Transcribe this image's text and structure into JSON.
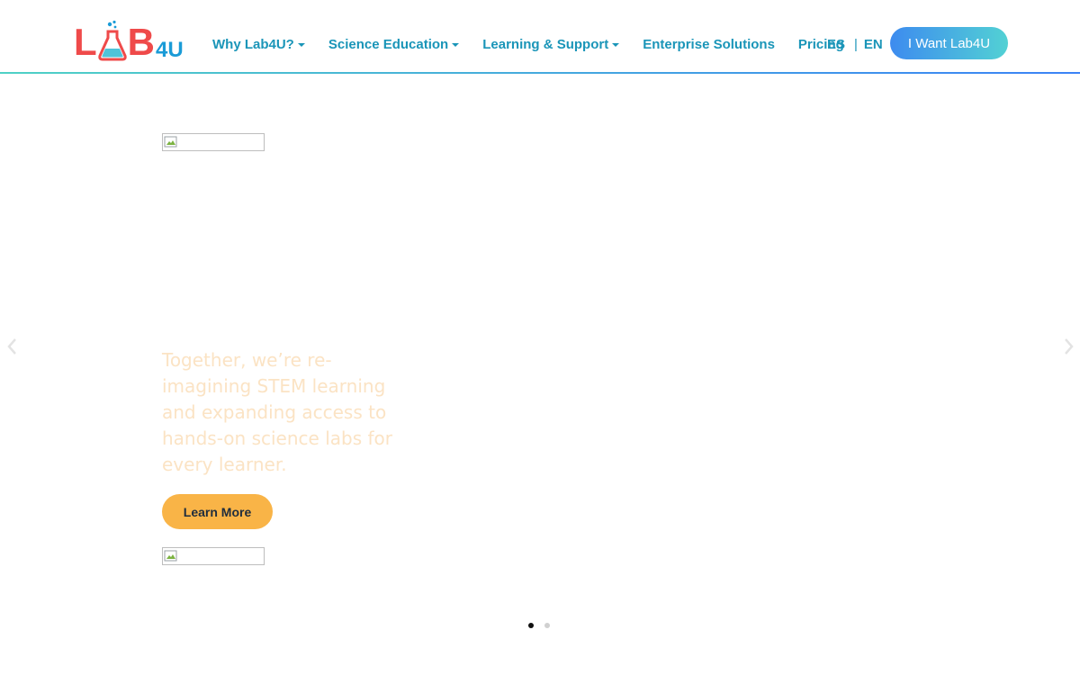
{
  "brand": {
    "logo_letter_1": "L",
    "logo_letter_2": "B",
    "logo_suffix": "4U",
    "logo_red": "#ef4a4a",
    "logo_blue": "#1a9bd7"
  },
  "nav": {
    "items": [
      {
        "label": "Why Lab4U?",
        "dropdown": true
      },
      {
        "label": "Science Education",
        "dropdown": true
      },
      {
        "label": "Learning & Support",
        "dropdown": true
      },
      {
        "label": "Enterprise Solutions",
        "dropdown": false
      },
      {
        "label": "Pricing",
        "dropdown": false
      }
    ],
    "lang_es": "ES",
    "lang_sep": "|",
    "lang_en": "EN",
    "cta_label": "I Want Lab4U"
  },
  "carousel": {
    "headline": "Together, we’re re-imagining STEM learning and expanding access to hands-on science labs for every learner.",
    "button_label": "Learn More",
    "prev_icon": "chevron-left-icon",
    "next_icon": "chevron-right-icon",
    "slide_count": 2,
    "active_slide": 1
  },
  "colors": {
    "nav_text": "#1a95b8",
    "cta_gradient_start": "#3d8bef",
    "cta_gradient_end": "#52d1d4",
    "learn_button": "#f9b447",
    "headline_text": "#fbe3c4"
  }
}
